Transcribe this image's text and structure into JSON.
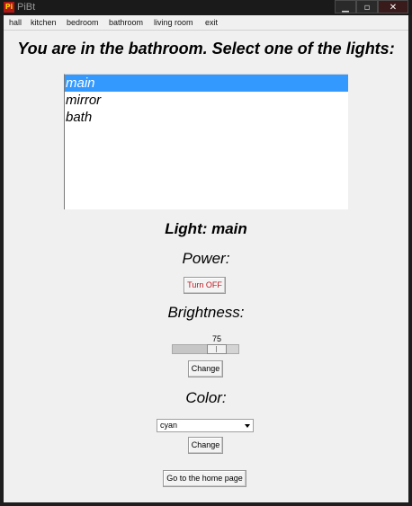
{
  "window": {
    "title": "PiBt",
    "icon_text": "Pi"
  },
  "titlebar_buttons": {
    "minimize": "▁",
    "maximize": "▫",
    "close": "✕"
  },
  "menu": [
    "hall",
    "kitchen",
    "bedroom",
    "bathroom",
    "living room",
    "exit"
  ],
  "heading": "You are in the bathroom. Select one of the lights:",
  "lights": {
    "items": [
      "main",
      "mirror",
      "bath"
    ],
    "selected_index": 0
  },
  "light_title": "Light: main",
  "power": {
    "label": "Power:",
    "button": "Turn OFF",
    "button_color": "#c0141c"
  },
  "brightness": {
    "label": "Brightness:",
    "value": "75",
    "level": 0.75,
    "button": "Change"
  },
  "color": {
    "label": "Color:",
    "selected": "cyan",
    "button": "Change"
  },
  "home_button": "Go to the home page",
  "colors": {
    "selection": "#3399ff",
    "background": "#f0f0f0"
  }
}
